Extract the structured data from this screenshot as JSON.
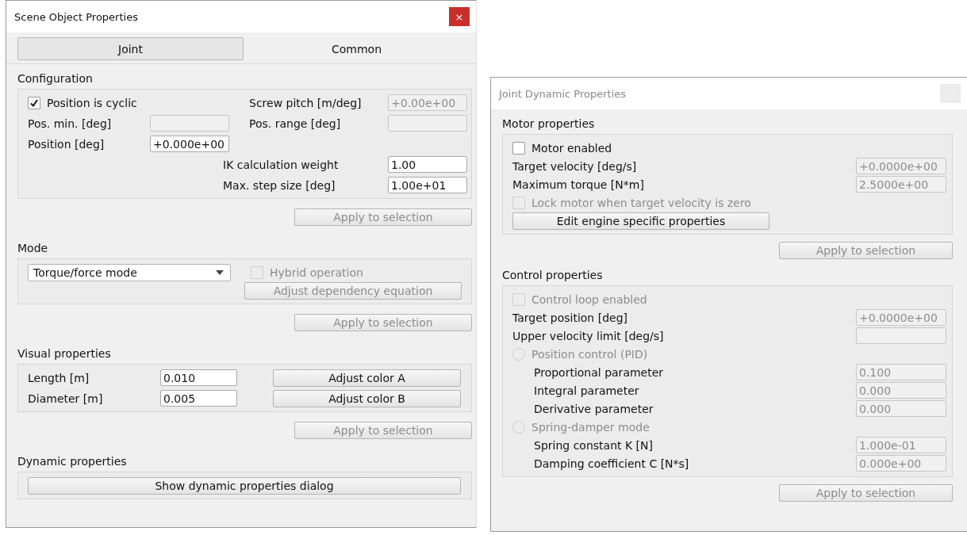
{
  "scene_window": {
    "title": "Scene Object Properties",
    "close": "×",
    "tabs": [
      {
        "label": "Joint",
        "selected": true
      },
      {
        "label": "Common",
        "selected": false
      }
    ],
    "configuration": {
      "heading": "Configuration",
      "cyclic": {
        "label": "Position is cyclic",
        "checked": true,
        "disabled": false
      },
      "screw_pitch": {
        "label": "Screw pitch [m/deg]",
        "value": "+0.00e+00",
        "disabled": true
      },
      "pos_min": {
        "label": "Pos. min. [deg]",
        "disabled": true
      },
      "pos_range": {
        "label": "Pos. range [deg]",
        "disabled": true
      },
      "position": {
        "label": "Position [deg]",
        "value": "+0.000e+00",
        "disabled": false
      },
      "ik_weight": {
        "label": "IK calculation weight",
        "value": "1.00",
        "disabled": false
      },
      "max_step": {
        "label": "Max. step size [deg]",
        "value": "1.00e+01",
        "disabled": false
      },
      "apply": {
        "label": "Apply to selection",
        "disabled": true
      }
    },
    "mode": {
      "heading": "Mode",
      "dropdown": "Torque/force mode",
      "hybrid": {
        "label": "Hybrid operation",
        "checked": false,
        "disabled": true
      },
      "dependency": {
        "label": "Adjust dependency equation",
        "disabled": true
      },
      "apply": {
        "label": "Apply to selection",
        "disabled": true
      }
    },
    "visual": {
      "heading": "Visual properties",
      "rows": [
        {
          "label": "Length [m]",
          "value": "0.010",
          "disabled": false,
          "button": "Adjust color A"
        },
        {
          "label": "Diameter [m]",
          "value": "0.005",
          "disabled": false,
          "button": "Adjust color B"
        }
      ],
      "apply": {
        "label": "Apply to selection",
        "disabled": true
      }
    },
    "dynamic": {
      "heading": "Dynamic properties",
      "button": {
        "label": "Show dynamic properties dialog",
        "disabled": false
      }
    }
  },
  "dynamic_window": {
    "title": "Joint Dynamic Properties",
    "sections": [
      {
        "heading": "Motor properties",
        "rows": [
          {
            "kind": "checkbox",
            "label": "Motor enabled",
            "checked": false,
            "disabled": false
          },
          {
            "kind": "field",
            "label": "Target velocity [deg/s]",
            "value": "+0.0000e+00",
            "disabled": true
          },
          {
            "kind": "field",
            "label": "Maximum torque [N*m]",
            "value": "2.5000e+00",
            "disabled": true
          },
          {
            "kind": "checkbox",
            "label": "Lock motor when target velocity is zero",
            "checked": false,
            "disabled": true
          },
          {
            "kind": "button",
            "label": "Edit engine specific properties",
            "disabled": false
          }
        ],
        "apply": {
          "label": "Apply to selection",
          "disabled": true
        }
      },
      {
        "heading": "Control properties",
        "rows": [
          {
            "kind": "checkbox",
            "label": "Control loop enabled",
            "checked": false,
            "disabled": true
          },
          {
            "kind": "field",
            "label": "Target position [deg]",
            "value": "+0.0000e+00",
            "disabled": true
          },
          {
            "kind": "field",
            "label": "Upper velocity limit [deg/s]",
            "disabled": true
          },
          {
            "kind": "radio",
            "label": "Position control (PID)",
            "selected": false,
            "disabled": true,
            "children": [
              {
                "kind": "field",
                "label": "Proportional parameter",
                "value": "0.100",
                "disabled": true
              },
              {
                "kind": "field",
                "label": "Integral parameter",
                "value": "0.000",
                "disabled": true
              },
              {
                "kind": "field",
                "label": "Derivative parameter",
                "value": "0.000",
                "disabled": true
              }
            ]
          },
          {
            "kind": "radio",
            "label": "Spring-damper mode",
            "selected": false,
            "disabled": true,
            "children": [
              {
                "kind": "field",
                "label": "Spring constant K [N]",
                "value": "1.000e-01",
                "disabled": true
              },
              {
                "kind": "field",
                "label": "Damping coefficient C [N*s]",
                "value": "0.000e+00",
                "disabled": true
              }
            ]
          }
        ],
        "apply": {
          "label": "Apply to selection",
          "disabled": true
        }
      }
    ]
  }
}
